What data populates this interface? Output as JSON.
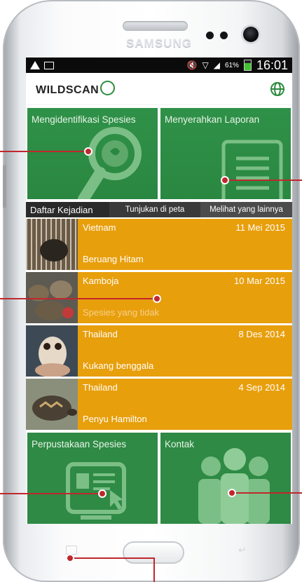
{
  "device": {
    "brand": "SAMSUNG"
  },
  "status_bar": {
    "battery": "61%",
    "time": "16:01"
  },
  "app": {
    "logo_text": "WILDSCAN"
  },
  "tiles": {
    "identify": "Mengidentifikasi Spesies",
    "report": "Menyerahkan Laporan",
    "library": "Perpustakaan Spesies",
    "contact": "Kontak"
  },
  "tabs": {
    "incidents": "Daftar Kejadian",
    "map": "Tunjukan di peta",
    "more": "Melihat yang lainnya"
  },
  "incidents": [
    {
      "country": "Vietnam",
      "date": "11 Mei 2015",
      "species": "Beruang Hitam"
    },
    {
      "country": "Kamboja",
      "date": "10 Mar 2015",
      "species": "Spesies yang tidak"
    },
    {
      "country": "Thailand",
      "date": "8 Des 2014",
      "species": "Kukang benggala"
    },
    {
      "country": "Thailand",
      "date": "4 Sep 2014",
      "species": "Penyu Hamilton"
    }
  ],
  "colors": {
    "tile_green": "#2e8a44",
    "row_orange": "#e89f0c",
    "callout_red": "#c0272d"
  }
}
